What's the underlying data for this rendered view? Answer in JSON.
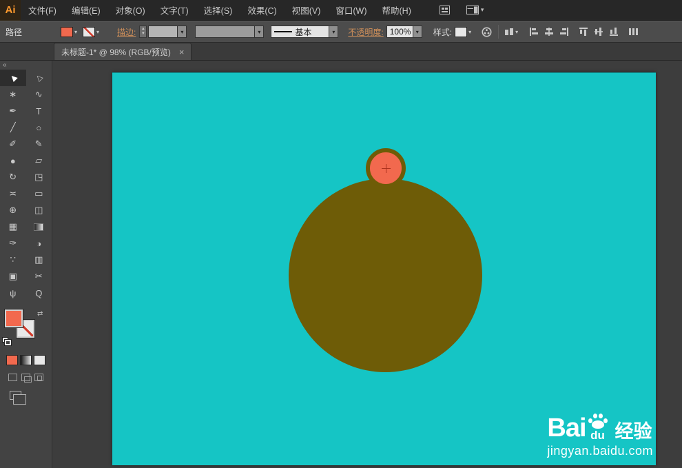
{
  "app": {
    "logo_text": "Ai"
  },
  "menubar": {
    "items": [
      "文件(F)",
      "编辑(E)",
      "对象(O)",
      "文字(T)",
      "选择(S)",
      "效果(C)",
      "视图(V)",
      "窗口(W)",
      "帮助(H)"
    ]
  },
  "control_bar": {
    "selection_type": "路径",
    "stroke_label": "描边:",
    "stroke_weight_value": "",
    "brush_value": "",
    "profile_value": "基本",
    "opacity_label": "不透明度:",
    "opacity_value": "100%",
    "style_label": "样式:"
  },
  "tab_bar": {
    "collapse_glyph": "«",
    "title": "未标题-1* @ 98% (RGB/预览)",
    "close_glyph": "×"
  },
  "toolbar": {
    "tools": [
      {
        "name": "selection",
        "glyph": "▶"
      },
      {
        "name": "direct-selection",
        "glyph": "▷"
      },
      {
        "name": "magic-wand",
        "glyph": "∗"
      },
      {
        "name": "lasso",
        "glyph": "∿"
      },
      {
        "name": "pen",
        "glyph": "✒"
      },
      {
        "name": "type",
        "glyph": "T"
      },
      {
        "name": "line-segment",
        "glyph": "╱"
      },
      {
        "name": "ellipse",
        "glyph": "○"
      },
      {
        "name": "paintbrush",
        "glyph": "✐"
      },
      {
        "name": "pencil",
        "glyph": "✎"
      },
      {
        "name": "blob-brush",
        "glyph": "●"
      },
      {
        "name": "eraser",
        "glyph": "▱"
      },
      {
        "name": "rotate",
        "glyph": "↻"
      },
      {
        "name": "scale",
        "glyph": "◳"
      },
      {
        "name": "width",
        "glyph": "≍"
      },
      {
        "name": "free-transform",
        "glyph": "▭"
      },
      {
        "name": "shape-builder",
        "glyph": "⊕"
      },
      {
        "name": "perspective-grid",
        "glyph": "◫"
      },
      {
        "name": "mesh",
        "glyph": "▦"
      },
      {
        "name": "gradient",
        "glyph": ""
      },
      {
        "name": "eyedropper",
        "glyph": "✑"
      },
      {
        "name": "blend",
        "glyph": "◑"
      },
      {
        "name": "symbol-sprayer",
        "glyph": "∵"
      },
      {
        "name": "column-graph",
        "glyph": "▥"
      },
      {
        "name": "artboard",
        "glyph": "▣"
      },
      {
        "name": "slice",
        "glyph": "✂"
      },
      {
        "name": "hand",
        "glyph": "ψ"
      },
      {
        "name": "zoom",
        "glyph": "Q"
      }
    ],
    "swap_glyph": "⇄"
  },
  "colors": {
    "artboard_fill": "#15c5c5",
    "large_circle_fill": "#6e5c07",
    "small_circle_fill": "#f2694e",
    "small_circle_stroke": "#6e5c07",
    "current_fill": "#f2694e"
  },
  "canvas": {
    "zoom_percent": "98%"
  },
  "watermark": {
    "bai": "Bai",
    "du": "du",
    "brand": "经验",
    "url": "jingyan.baidu.com"
  }
}
